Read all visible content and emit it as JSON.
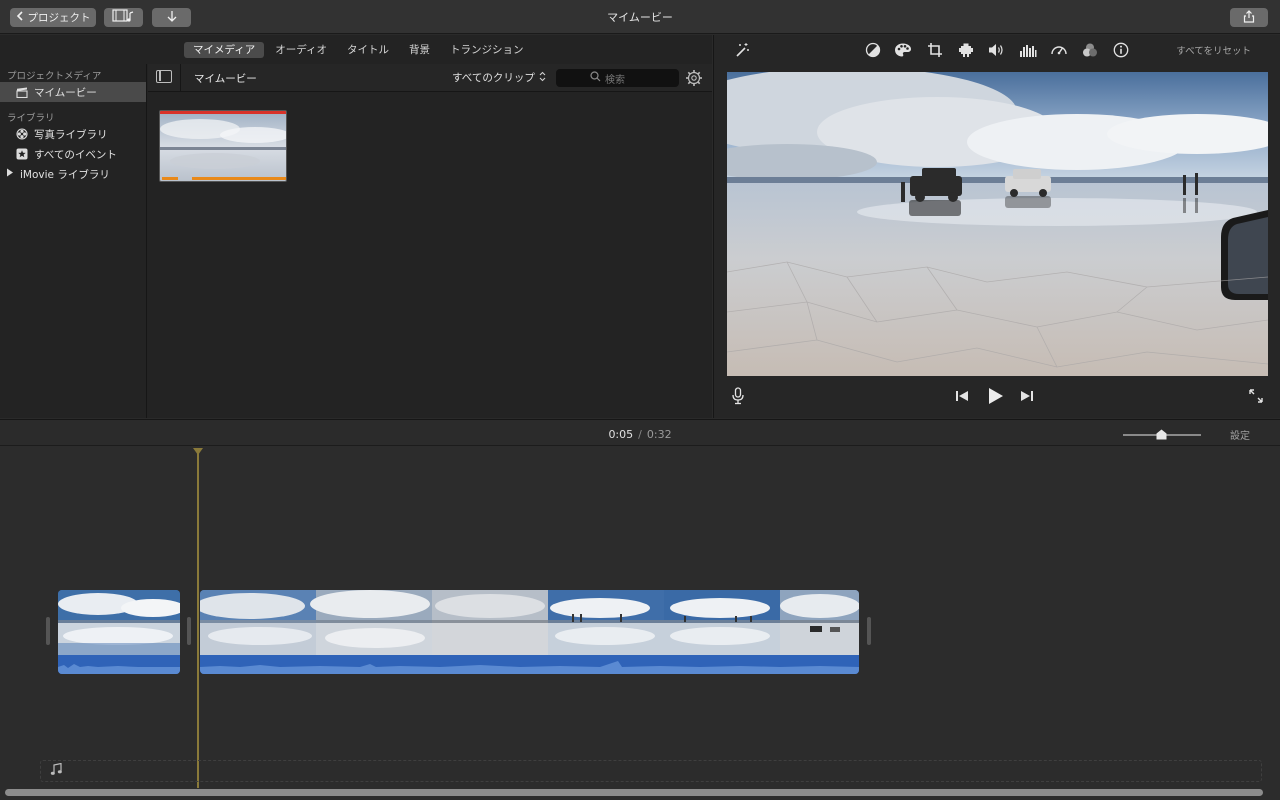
{
  "window": {
    "title": "マイムービー",
    "back_label": "プロジェクト"
  },
  "browser": {
    "tabs": [
      {
        "label": "マイメディア",
        "active": true
      },
      {
        "label": "オーディオ",
        "active": false
      },
      {
        "label": "タイトル",
        "active": false
      },
      {
        "label": "背景",
        "active": false
      },
      {
        "label": "トランジション",
        "active": false
      }
    ],
    "sidebar": {
      "project_heading": "プロジェクトメディア",
      "project_item": "マイムービー",
      "library_heading": "ライブラリ",
      "library_items": [
        {
          "label": "写真ライブラリ",
          "icon": "photos-icon"
        },
        {
          "label": "すべてのイベント",
          "icon": "star-icon"
        }
      ],
      "imovie_library": "iMovie ライブラリ"
    },
    "content_title": "マイムービー",
    "filter_label": "すべてのクリップ",
    "search_placeholder": "検索"
  },
  "viewer": {
    "reset_label": "すべてをリセット",
    "adjust_icons": [
      "color-balance-icon",
      "color-correction-icon",
      "crop-icon",
      "stabilization-icon",
      "volume-icon",
      "noise-reduction-icon",
      "speed-icon",
      "clip-filter-icon",
      "info-icon"
    ]
  },
  "timeline": {
    "current_time": "0:05",
    "separator": "/",
    "duration": "0:32",
    "settings_label": "設定"
  },
  "colors": {
    "audio_blue": "#2f63b8",
    "accent_orange": "#e8891a",
    "selection_red": "#d8322a"
  }
}
